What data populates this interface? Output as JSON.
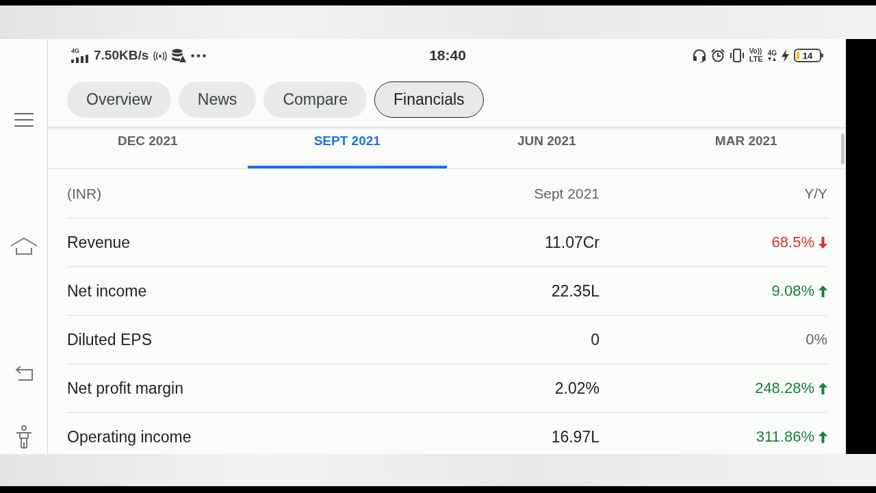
{
  "status_bar": {
    "network_type": "4G",
    "speed": "7.50KB/s",
    "time": "18:40",
    "volte": "Vo))",
    "volte_sub": "LTE",
    "data_type": "4G",
    "charging": true,
    "battery": "14"
  },
  "tabs": [
    {
      "label": "Overview",
      "selected": false
    },
    {
      "label": "News",
      "selected": false
    },
    {
      "label": "Compare",
      "selected": false
    },
    {
      "label": "Financials",
      "selected": true
    }
  ],
  "periods": [
    {
      "label": "DEC 2021",
      "selected": false
    },
    {
      "label": "SEPT 2021",
      "selected": true
    },
    {
      "label": "JUN 2021",
      "selected": false
    },
    {
      "label": "MAR 2021",
      "selected": false
    }
  ],
  "table": {
    "columns": [
      "(INR)",
      "Sept 2021",
      "Y/Y"
    ],
    "rows": [
      {
        "kind": "down",
        "label": "Revenue",
        "value": "11.07Cr",
        "change": "68.5%"
      },
      {
        "kind": "up",
        "label": "Net income",
        "value": "22.35L",
        "change": "9.08%"
      },
      {
        "kind": "flat",
        "label": "Diluted EPS",
        "value": "0",
        "change": "0%"
      },
      {
        "kind": "up",
        "label": "Net profit margin",
        "value": "2.02%",
        "change": "248.28%"
      },
      {
        "kind": "up",
        "label": "Operating income",
        "value": "16.97L",
        "change": "311.86%"
      }
    ]
  }
}
